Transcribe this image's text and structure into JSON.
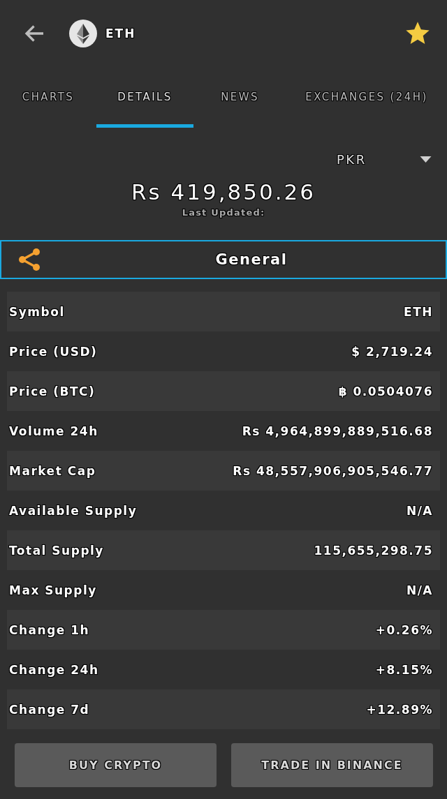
{
  "header": {
    "title": "ETH",
    "favorite": true
  },
  "tabs": [
    {
      "label": "CHARTS",
      "selected": false
    },
    {
      "label": "DETAILS",
      "selected": true
    },
    {
      "label": "NEWS",
      "selected": false
    },
    {
      "label": "EXCHANGES (24H)",
      "selected": false
    }
  ],
  "currency": {
    "value": "PKR"
  },
  "price": {
    "value": "Rs 419,850.26",
    "updated": "Last Updated:"
  },
  "section": {
    "title": "General"
  },
  "details": [
    {
      "label": "Symbol",
      "value": "ETH"
    },
    {
      "label": "Price (USD)",
      "value": "$ 2,719.24"
    },
    {
      "label": "Price (BTC)",
      "value": "฿ 0.0504076"
    },
    {
      "label": "Volume 24h",
      "value": "Rs 4,964,899,889,516.68"
    },
    {
      "label": "Market Cap",
      "value": "Rs 48,557,906,905,546.77"
    },
    {
      "label": "Available Supply",
      "value": "N/A"
    },
    {
      "label": "Total Supply",
      "value": "115,655,298.75"
    },
    {
      "label": "Max Supply",
      "value": "N/A"
    },
    {
      "label": "Change 1h",
      "value": "+0.26%"
    },
    {
      "label": "Change 24h",
      "value": "+8.15%"
    },
    {
      "label": "Change 7d",
      "value": "+12.89%"
    }
  ],
  "buttons": [
    {
      "label": "BUY CRYPTO"
    },
    {
      "label": "TRADE IN BINANCE"
    }
  ]
}
